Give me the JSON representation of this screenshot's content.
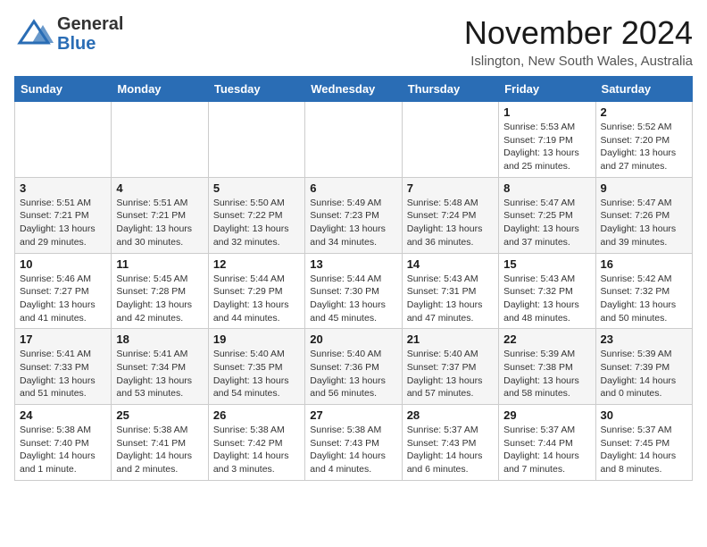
{
  "header": {
    "logo_general": "General",
    "logo_blue": "Blue",
    "month_title": "November 2024",
    "location": "Islington, New South Wales, Australia"
  },
  "calendar": {
    "days_of_week": [
      "Sunday",
      "Monday",
      "Tuesday",
      "Wednesday",
      "Thursday",
      "Friday",
      "Saturday"
    ],
    "weeks": [
      [
        {
          "day": "",
          "info": ""
        },
        {
          "day": "",
          "info": ""
        },
        {
          "day": "",
          "info": ""
        },
        {
          "day": "",
          "info": ""
        },
        {
          "day": "",
          "info": ""
        },
        {
          "day": "1",
          "info": "Sunrise: 5:53 AM\nSunset: 7:19 PM\nDaylight: 13 hours\nand 25 minutes."
        },
        {
          "day": "2",
          "info": "Sunrise: 5:52 AM\nSunset: 7:20 PM\nDaylight: 13 hours\nand 27 minutes."
        }
      ],
      [
        {
          "day": "3",
          "info": "Sunrise: 5:51 AM\nSunset: 7:21 PM\nDaylight: 13 hours\nand 29 minutes."
        },
        {
          "day": "4",
          "info": "Sunrise: 5:51 AM\nSunset: 7:21 PM\nDaylight: 13 hours\nand 30 minutes."
        },
        {
          "day": "5",
          "info": "Sunrise: 5:50 AM\nSunset: 7:22 PM\nDaylight: 13 hours\nand 32 minutes."
        },
        {
          "day": "6",
          "info": "Sunrise: 5:49 AM\nSunset: 7:23 PM\nDaylight: 13 hours\nand 34 minutes."
        },
        {
          "day": "7",
          "info": "Sunrise: 5:48 AM\nSunset: 7:24 PM\nDaylight: 13 hours\nand 36 minutes."
        },
        {
          "day": "8",
          "info": "Sunrise: 5:47 AM\nSunset: 7:25 PM\nDaylight: 13 hours\nand 37 minutes."
        },
        {
          "day": "9",
          "info": "Sunrise: 5:47 AM\nSunset: 7:26 PM\nDaylight: 13 hours\nand 39 minutes."
        }
      ],
      [
        {
          "day": "10",
          "info": "Sunrise: 5:46 AM\nSunset: 7:27 PM\nDaylight: 13 hours\nand 41 minutes."
        },
        {
          "day": "11",
          "info": "Sunrise: 5:45 AM\nSunset: 7:28 PM\nDaylight: 13 hours\nand 42 minutes."
        },
        {
          "day": "12",
          "info": "Sunrise: 5:44 AM\nSunset: 7:29 PM\nDaylight: 13 hours\nand 44 minutes."
        },
        {
          "day": "13",
          "info": "Sunrise: 5:44 AM\nSunset: 7:30 PM\nDaylight: 13 hours\nand 45 minutes."
        },
        {
          "day": "14",
          "info": "Sunrise: 5:43 AM\nSunset: 7:31 PM\nDaylight: 13 hours\nand 47 minutes."
        },
        {
          "day": "15",
          "info": "Sunrise: 5:43 AM\nSunset: 7:32 PM\nDaylight: 13 hours\nand 48 minutes."
        },
        {
          "day": "16",
          "info": "Sunrise: 5:42 AM\nSunset: 7:32 PM\nDaylight: 13 hours\nand 50 minutes."
        }
      ],
      [
        {
          "day": "17",
          "info": "Sunrise: 5:41 AM\nSunset: 7:33 PM\nDaylight: 13 hours\nand 51 minutes."
        },
        {
          "day": "18",
          "info": "Sunrise: 5:41 AM\nSunset: 7:34 PM\nDaylight: 13 hours\nand 53 minutes."
        },
        {
          "day": "19",
          "info": "Sunrise: 5:40 AM\nSunset: 7:35 PM\nDaylight: 13 hours\nand 54 minutes."
        },
        {
          "day": "20",
          "info": "Sunrise: 5:40 AM\nSunset: 7:36 PM\nDaylight: 13 hours\nand 56 minutes."
        },
        {
          "day": "21",
          "info": "Sunrise: 5:40 AM\nSunset: 7:37 PM\nDaylight: 13 hours\nand 57 minutes."
        },
        {
          "day": "22",
          "info": "Sunrise: 5:39 AM\nSunset: 7:38 PM\nDaylight: 13 hours\nand 58 minutes."
        },
        {
          "day": "23",
          "info": "Sunrise: 5:39 AM\nSunset: 7:39 PM\nDaylight: 14 hours\nand 0 minutes."
        }
      ],
      [
        {
          "day": "24",
          "info": "Sunrise: 5:38 AM\nSunset: 7:40 PM\nDaylight: 14 hours\nand 1 minute."
        },
        {
          "day": "25",
          "info": "Sunrise: 5:38 AM\nSunset: 7:41 PM\nDaylight: 14 hours\nand 2 minutes."
        },
        {
          "day": "26",
          "info": "Sunrise: 5:38 AM\nSunset: 7:42 PM\nDaylight: 14 hours\nand 3 minutes."
        },
        {
          "day": "27",
          "info": "Sunrise: 5:38 AM\nSunset: 7:43 PM\nDaylight: 14 hours\nand 4 minutes."
        },
        {
          "day": "28",
          "info": "Sunrise: 5:37 AM\nSunset: 7:43 PM\nDaylight: 14 hours\nand 6 minutes."
        },
        {
          "day": "29",
          "info": "Sunrise: 5:37 AM\nSunset: 7:44 PM\nDaylight: 14 hours\nand 7 minutes."
        },
        {
          "day": "30",
          "info": "Sunrise: 5:37 AM\nSunset: 7:45 PM\nDaylight: 14 hours\nand 8 minutes."
        }
      ]
    ]
  }
}
